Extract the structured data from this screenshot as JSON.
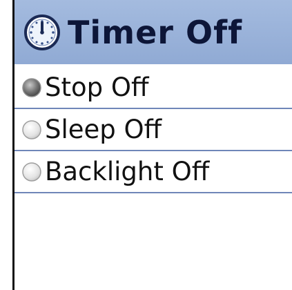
{
  "header": {
    "icon": "clock-icon",
    "title": "Timer Off"
  },
  "options": [
    {
      "label": "Stop Off",
      "selected": true
    },
    {
      "label": "Sleep Off",
      "selected": false
    },
    {
      "label": "Backlight Off",
      "selected": false
    }
  ],
  "colors": {
    "header_bg": "#9cb4dc",
    "divider": "#6f86b8",
    "title_text": "#0d1638"
  }
}
